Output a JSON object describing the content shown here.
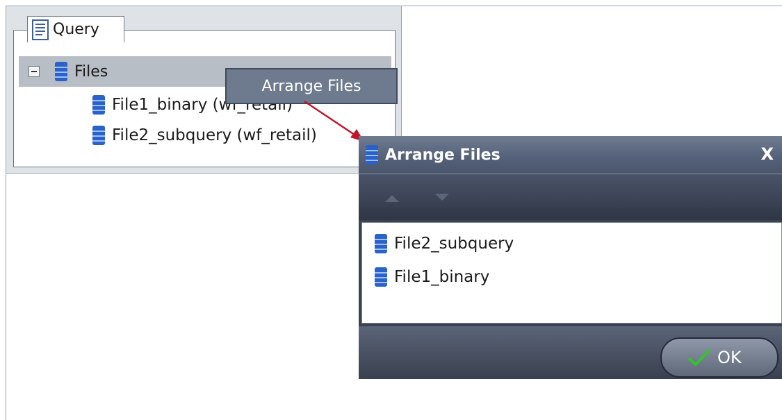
{
  "query_panel": {
    "tab_label": "Query",
    "tree": {
      "root_label": "Files",
      "children": [
        {
          "label": "File1_binary (wf_retail)"
        },
        {
          "label": "File2_subquery (wf_retail)"
        }
      ]
    }
  },
  "context_menu": {
    "item_label": "Arrange Files"
  },
  "dialog": {
    "title": "Arrange Files",
    "close_label": "X",
    "toolbar": {
      "move_up_icon": "arrow-up-icon",
      "move_down_icon": "arrow-down-icon"
    },
    "list_items": [
      {
        "label": "File2_subquery"
      },
      {
        "label": "File1_binary"
      }
    ],
    "ok_label": "OK"
  },
  "colors": {
    "dialog_bg": "#3b4250",
    "arrow": "#c0162b",
    "db_icon": "#2a62c9"
  }
}
